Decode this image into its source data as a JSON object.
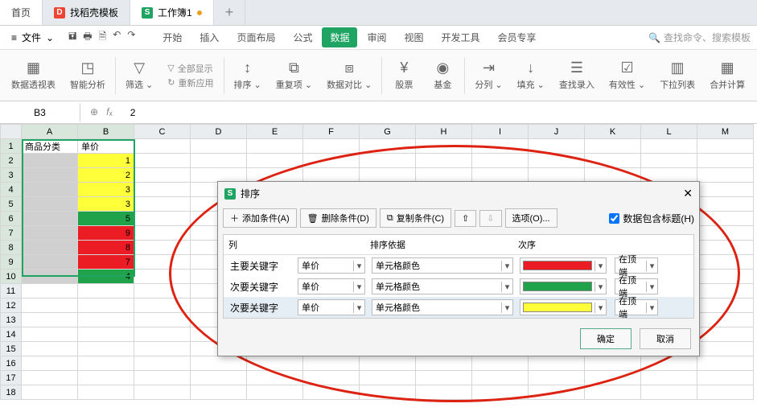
{
  "tabs": {
    "home": "首页",
    "t1": "找稻壳模板",
    "t2": "工作簿1"
  },
  "file_menu": "文件",
  "ribbon_tabs": [
    "开始",
    "插入",
    "页面布局",
    "公式",
    "数据",
    "审阅",
    "视图",
    "开发工具",
    "会员专享"
  ],
  "ribbon_active_index": 4,
  "search_placeholder": "查找命令、搜索模板",
  "ribbon_buttons": {
    "pivot": "数据透视表",
    "smart": "智能分析",
    "filter": "筛选",
    "showall": "全部显示",
    "reapply": "重新应用",
    "sort": "排序",
    "dup": "重复项",
    "compare": "数据对比",
    "stock": "股票",
    "fund": "基金",
    "split": "分列",
    "fill": "填充",
    "findrec": "查找录入",
    "valid": "有效性",
    "dropdown": "下拉列表",
    "consol": "合并计算"
  },
  "name_box": "B3",
  "formula_value": "2",
  "headers": {
    "a": "商品分类",
    "b": "单价"
  },
  "col_letters": [
    "A",
    "B",
    "C",
    "D",
    "E",
    "F",
    "G",
    "H",
    "I",
    "J",
    "K",
    "L",
    "M"
  ],
  "data_rows": [
    {
      "b": "1",
      "color": "#ffff3a"
    },
    {
      "b": "2",
      "color": "#ffff3a"
    },
    {
      "b": "3",
      "color": "#ffff3a"
    },
    {
      "b": "3",
      "color": "#ffff3a"
    },
    {
      "b": "5",
      "color": "#1fa24a"
    },
    {
      "b": "9",
      "color": "#ec1c24"
    },
    {
      "b": "8",
      "color": "#ec1c24"
    },
    {
      "b": "7",
      "color": "#ec1c24"
    },
    {
      "b": "4",
      "color": "#1fa24a"
    }
  ],
  "dialog": {
    "title": "排序",
    "add": "添加条件(A)",
    "del": "删除条件(D)",
    "copy": "复制条件(C)",
    "opts": "选项(O)...",
    "header_chk": "数据包含标题(H)",
    "col_h": "列",
    "basis_h": "排序依据",
    "order_h": "次序",
    "primary": "主要关键字",
    "secondary": "次要关键字",
    "field": "单价",
    "basis": "单元格颜色",
    "pos": "在顶端",
    "colors": [
      "#ec1c24",
      "#1fa24a",
      "#ffff3a"
    ],
    "ok": "确定",
    "cancel": "取消"
  }
}
